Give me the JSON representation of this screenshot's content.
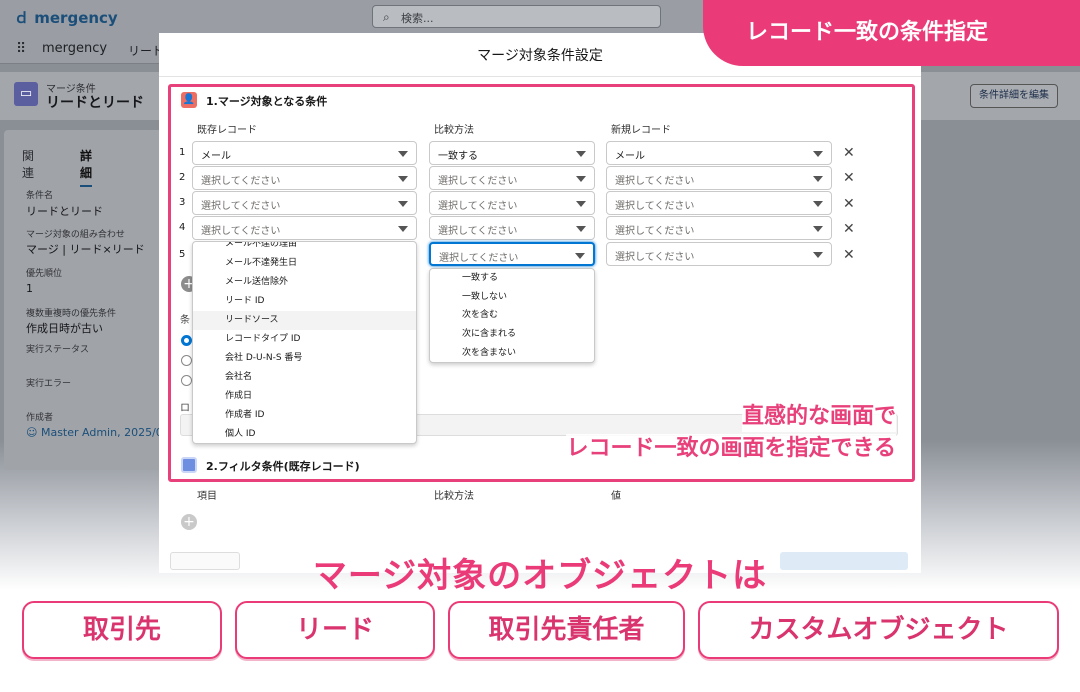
{
  "app": {
    "logo": "mergency",
    "search_placeholder": "検索...",
    "app_name": "mergency",
    "nav_item": "リード"
  },
  "record": {
    "object_label": "マージ条件",
    "title": "リードとリード",
    "edit_button": "条件詳細を編集"
  },
  "left": {
    "tab_related": "関連",
    "tab_detail": "詳細",
    "fields": [
      {
        "label": "条件名",
        "value": "リードとリード"
      },
      {
        "label": "マージ対象の組み合わせ",
        "value": "マージ | リード×リード"
      },
      {
        "label": "優先順位",
        "value": "1"
      },
      {
        "label": "複数重複時の優先条件",
        "value": "作成日時が古い"
      },
      {
        "label": "実行ステータス",
        "value": ""
      },
      {
        "label": "実行エラー",
        "value": ""
      },
      {
        "label": "作成者",
        "value": "Master Admin, 2025/05/"
      }
    ]
  },
  "modal": {
    "title": "マージ対象条件設定",
    "section1_title": "1.マージ対象となる条件",
    "col_existing": "既存レコード",
    "col_compare": "比較方法",
    "col_new": "新規レコード",
    "rows": [
      {
        "n": "1",
        "existing": "メール",
        "compare": "一致する",
        "new": "メール"
      },
      {
        "n": "2",
        "existing": "選択してください",
        "compare": "選択してください",
        "new": "選択してください"
      },
      {
        "n": "3",
        "existing": "選択してください",
        "compare": "選択してください",
        "new": "選択してください"
      },
      {
        "n": "4",
        "existing": "選択してください",
        "compare": "選択してください",
        "new": "選択してください"
      },
      {
        "n": "5",
        "existing": "",
        "compare": "選択してください",
        "new": "選択してください"
      }
    ],
    "field_dropdown": [
      "メール不達の理由",
      "メール不達発生日",
      "メール送信除外",
      "リード ID",
      "リードソース",
      "レコードタイプ ID",
      "会社 D-U-N-S 番号",
      "会社名",
      "作成日",
      "作成者 ID",
      "個人 ID"
    ],
    "compare_dropdown": [
      "一致する",
      "一致しない",
      "次を含む",
      "次に含まれる",
      "次を含まない"
    ],
    "section2_title": "2.フィルタ条件(既存レコード)",
    "s2_col_item": "項目",
    "s2_col_compare": "比較方法",
    "s2_col_value": "値",
    "partial_label_a": "条",
    "partial_label_b": "ロ"
  },
  "overlay": {
    "banner": "レコード一致の条件指定",
    "annotation_line1": "直感的な画面で",
    "annotation_line2": "レコード一致の画面を指定できる",
    "headline": "マージ対象のオブジェクトは",
    "pills": [
      "取引先",
      "リード",
      "取引先責任者",
      "カスタムオブジェクト"
    ]
  },
  "colors": {
    "accent_pink": "#ea3a77",
    "focus_blue": "#0176d3"
  }
}
